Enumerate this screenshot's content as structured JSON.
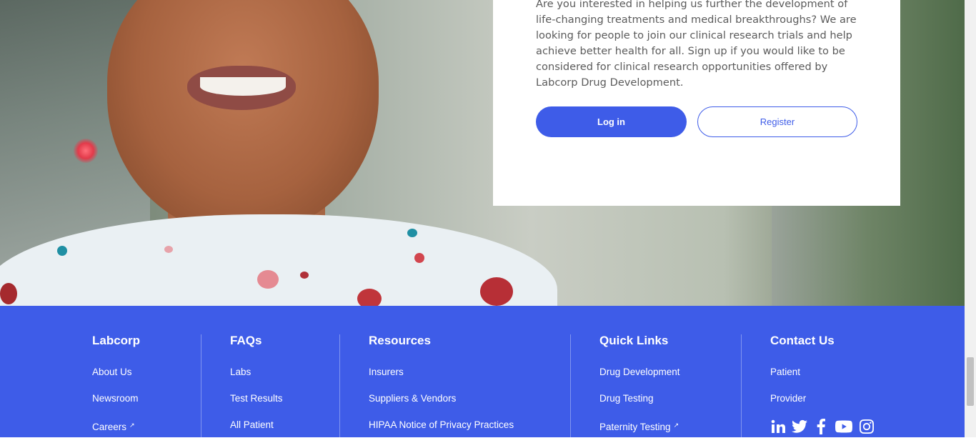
{
  "card": {
    "intro": "Are you interested in helping us further the development of life-changing treatments and medical breakthroughs? We are looking for people to join our clinical research trials and help achieve better health for all. Sign up if you would like to be considered for clinical research opportunities offered by Labcorp Drug Development.",
    "login_label": "Log in",
    "register_label": "Register"
  },
  "footer": {
    "columns": [
      {
        "title": "Labcorp",
        "links": [
          "About Us",
          "Newsroom",
          "Careers"
        ]
      },
      {
        "title": "FAQs",
        "links": [
          "Labs",
          "Test Results",
          "All Patient"
        ]
      },
      {
        "title": "Resources",
        "links": [
          "Insurers",
          "Suppliers & Vendors",
          "HIPAA Notice of Privacy Practices"
        ]
      },
      {
        "title": "Quick Links",
        "links": [
          "Drug Development",
          "Drug Testing",
          "Paternity Testing"
        ]
      },
      {
        "title": "Contact Us",
        "links": [
          "Patient",
          "Provider"
        ]
      }
    ],
    "external_marker": "↗",
    "social_icons": [
      "linkedin-icon",
      "twitter-icon",
      "facebook-icon",
      "youtube-icon",
      "instagram-icon"
    ]
  },
  "colors": {
    "brand_blue": "#3e5ce8",
    "text_gray": "#5b5b5b"
  }
}
